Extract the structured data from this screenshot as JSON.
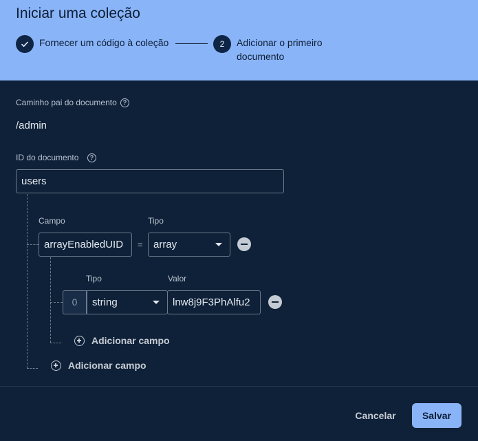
{
  "dialog": {
    "title": "Iniciar uma coleção"
  },
  "stepper": {
    "step1": {
      "label": "Fornecer um código à coleção",
      "state": "done"
    },
    "step2": {
      "number": "2",
      "label": "Adicionar o primeiro documento"
    }
  },
  "form": {
    "parent_path_label": "Caminho pai do documento",
    "parent_path_value": "/admin",
    "doc_id_label": "ID do documento",
    "doc_id_value": "users",
    "field_label": "Campo",
    "type_label": "Tipo",
    "value_label": "Valor",
    "field_name_value": "arrayEnabledUID",
    "equals_sign": "=",
    "field_type_value": "array",
    "array_item": {
      "index": "0",
      "type_label": "Tipo",
      "value_label": "Valor",
      "type_value": "string",
      "value": "lnw8j9F3PhAlfu2"
    },
    "add_field_nested": "Adicionar campo",
    "add_field_root": "Adicionar campo"
  },
  "footer": {
    "cancel_label": "Cancelar",
    "save_label": "Salvar"
  },
  "colors": {
    "header_bg": "#8ab4f8",
    "body_bg": "#0f2138",
    "primary_button": "#8ab4f8"
  }
}
